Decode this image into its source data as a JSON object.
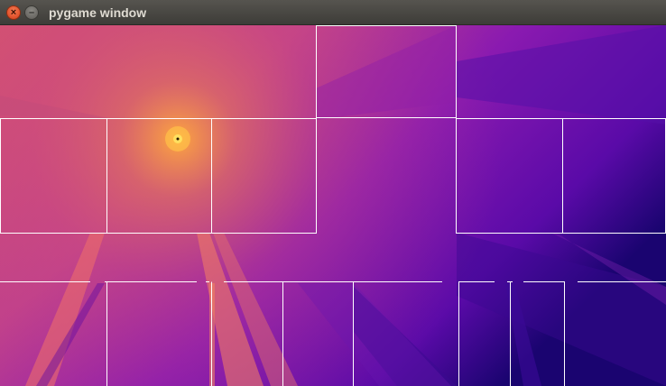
{
  "window": {
    "title": "pygame window",
    "close_glyph": "×",
    "minimize_glyph": "–",
    "close_icon": "close-icon",
    "minimize_icon": "minimize-icon"
  },
  "scene": {
    "light_color": "#ffb43c",
    "background_colors": [
      "#d4526f",
      "#c0408c",
      "#8a1ab0",
      "#5a0aa8",
      "#1a0470"
    ],
    "wall_outline_color": "#ffffff"
  }
}
